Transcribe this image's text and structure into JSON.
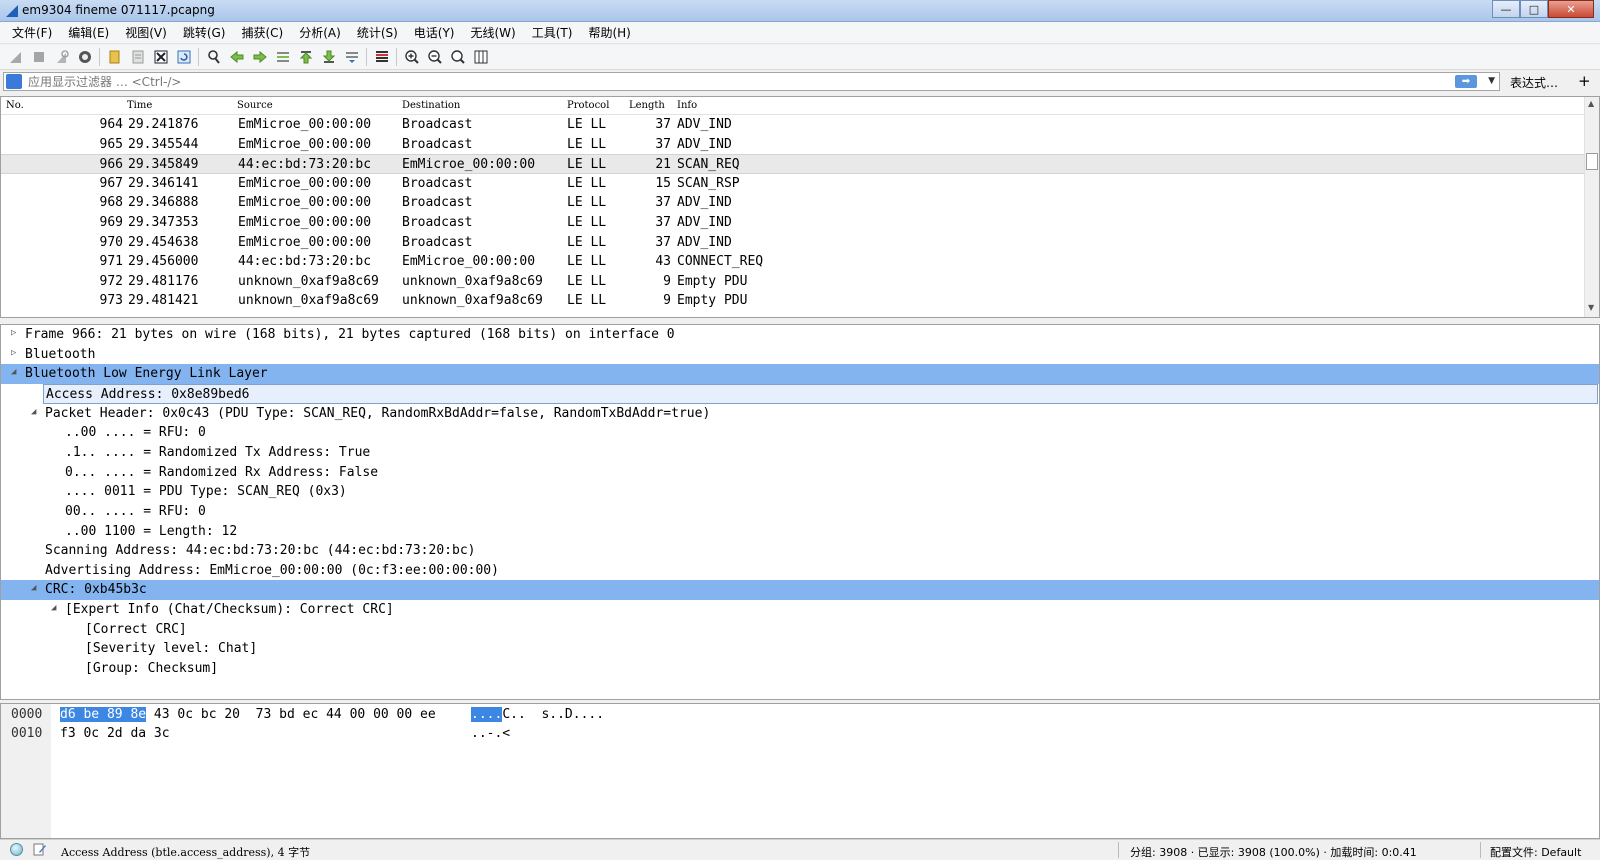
{
  "window": {
    "title": "em9304 fineme 071117.pcapng",
    "minimize": "—",
    "maximize": "□",
    "close": "✕"
  },
  "menu": [
    "文件(F)",
    "编辑(E)",
    "视图(V)",
    "跳转(G)",
    "捕获(C)",
    "分析(A)",
    "统计(S)",
    "电话(Y)",
    "无线(W)",
    "工具(T)",
    "帮助(H)"
  ],
  "filter": {
    "placeholder": "应用显示过滤器 … <Ctrl-/>",
    "apply": "➡",
    "dropdown": "▼",
    "expression": "表达式…",
    "add": "+"
  },
  "packet_list": {
    "columns": [
      "No.",
      "Time",
      "Source",
      "Destination",
      "Protocol",
      "Length",
      "Info"
    ],
    "selected_no": "966",
    "rows": [
      {
        "no": "964",
        "time": "29.241876",
        "src": "EmMicroe_00:00:00",
        "dst": "Broadcast",
        "proto": "LE LL",
        "len": "37",
        "info": "ADV_IND"
      },
      {
        "no": "965",
        "time": "29.345544",
        "src": "EmMicroe_00:00:00",
        "dst": "Broadcast",
        "proto": "LE LL",
        "len": "37",
        "info": "ADV_IND"
      },
      {
        "no": "966",
        "time": "29.345849",
        "src": "44:ec:bd:73:20:bc",
        "dst": "EmMicroe_00:00:00",
        "proto": "LE LL",
        "len": "21",
        "info": "SCAN_REQ"
      },
      {
        "no": "967",
        "time": "29.346141",
        "src": "EmMicroe_00:00:00",
        "dst": "Broadcast",
        "proto": "LE LL",
        "len": "15",
        "info": "SCAN_RSP"
      },
      {
        "no": "968",
        "time": "29.346888",
        "src": "EmMicroe_00:00:00",
        "dst": "Broadcast",
        "proto": "LE LL",
        "len": "37",
        "info": "ADV_IND"
      },
      {
        "no": "969",
        "time": "29.347353",
        "src": "EmMicroe_00:00:00",
        "dst": "Broadcast",
        "proto": "LE LL",
        "len": "37",
        "info": "ADV_IND"
      },
      {
        "no": "970",
        "time": "29.454638",
        "src": "EmMicroe_00:00:00",
        "dst": "Broadcast",
        "proto": "LE LL",
        "len": "37",
        "info": "ADV_IND"
      },
      {
        "no": "971",
        "time": "29.456000",
        "src": "44:ec:bd:73:20:bc",
        "dst": "EmMicroe_00:00:00",
        "proto": "LE LL",
        "len": "43",
        "info": "CONNECT_REQ"
      },
      {
        "no": "972",
        "time": "29.481176",
        "src": "unknown_0xaf9a8c69",
        "dst": "unknown_0xaf9a8c69",
        "proto": "LE LL",
        "len": "9",
        "info": "Empty PDU"
      },
      {
        "no": "973",
        "time": "29.481421",
        "src": "unknown_0xaf9a8c69",
        "dst": "unknown_0xaf9a8c69",
        "proto": "LE LL",
        "len": "9",
        "info": "Empty PDU"
      }
    ]
  },
  "details": [
    {
      "level": 0,
      "arrow": "collapsed",
      "state": "normal",
      "text": "Frame 966: 21 bytes on wire (168 bits), 21 bytes captured (168 bits) on interface 0"
    },
    {
      "level": 0,
      "arrow": "collapsed",
      "state": "normal",
      "text": "Bluetooth"
    },
    {
      "level": 0,
      "arrow": "expanded",
      "state": "highlight",
      "text": "Bluetooth Low Energy Link Layer"
    },
    {
      "level": 1,
      "arrow": "none",
      "state": "focus",
      "text": "Access Address: 0x8e89bed6"
    },
    {
      "level": 1,
      "arrow": "expanded",
      "state": "normal",
      "text": "Packet Header: 0x0c43 (PDU Type: SCAN_REQ, RandomRxBdAddr=false, RandomTxBdAddr=true)"
    },
    {
      "level": 2,
      "arrow": "none",
      "state": "normal",
      "text": "..00 .... = RFU: 0"
    },
    {
      "level": 2,
      "arrow": "none",
      "state": "normal",
      "text": ".1.. .... = Randomized Tx Address: True"
    },
    {
      "level": 2,
      "arrow": "none",
      "state": "normal",
      "text": "0... .... = Randomized Rx Address: False"
    },
    {
      "level": 2,
      "arrow": "none",
      "state": "normal",
      "text": ".... 0011 = PDU Type: SCAN_REQ (0x3)"
    },
    {
      "level": 2,
      "arrow": "none",
      "state": "normal",
      "text": "00.. .... = RFU: 0"
    },
    {
      "level": 2,
      "arrow": "none",
      "state": "normal",
      "text": "..00 1100 = Length: 12"
    },
    {
      "level": 1,
      "arrow": "none",
      "state": "normal",
      "text": "Scanning Address: 44:ec:bd:73:20:bc (44:ec:bd:73:20:bc)"
    },
    {
      "level": 1,
      "arrow": "none",
      "state": "normal",
      "text": "Advertising Address: EmMicroe_00:00:00 (0c:f3:ee:00:00:00)"
    },
    {
      "level": 1,
      "arrow": "expanded",
      "state": "highlight",
      "text": "CRC: 0xb45b3c"
    },
    {
      "level": 2,
      "arrow": "expanded",
      "state": "normal",
      "text": "[Expert Info (Chat/Checksum): Correct CRC]"
    },
    {
      "level": 3,
      "arrow": "none",
      "state": "normal",
      "text": "[Correct CRC]"
    },
    {
      "level": 3,
      "arrow": "none",
      "state": "normal",
      "text": "[Severity level: Chat]"
    },
    {
      "level": 3,
      "arrow": "none",
      "state": "normal",
      "text": "[Group: Checksum]"
    }
  ],
  "hex": {
    "rows": [
      {
        "offset": "0000",
        "bytes_mark": "d6 be 89 8e",
        "bytes_rest": " 43 0c bc 20  73 bd ec 44 00 00 00 ee",
        "ascii_mark": "....",
        "ascii_rest": "C..  s..D...."
      },
      {
        "offset": "0010",
        "bytes_mark": "",
        "bytes_rest": "f3 0c 2d da 3c",
        "ascii_mark": "",
        "ascii_rest": "..-.<"
      }
    ]
  },
  "status": {
    "field": "Access Address (btle.access_address), 4 字节",
    "stats": "分组: 3908 · 已显示: 3908 (100.0%) · 加载时间: 0:0.41",
    "profile": "配置文件: Default"
  },
  "colors": {
    "highlight": "#84b4f0",
    "focus_fill": "#e6effb",
    "hex_mark": "#3c86e4",
    "selected_row": "#e9e9e9"
  }
}
